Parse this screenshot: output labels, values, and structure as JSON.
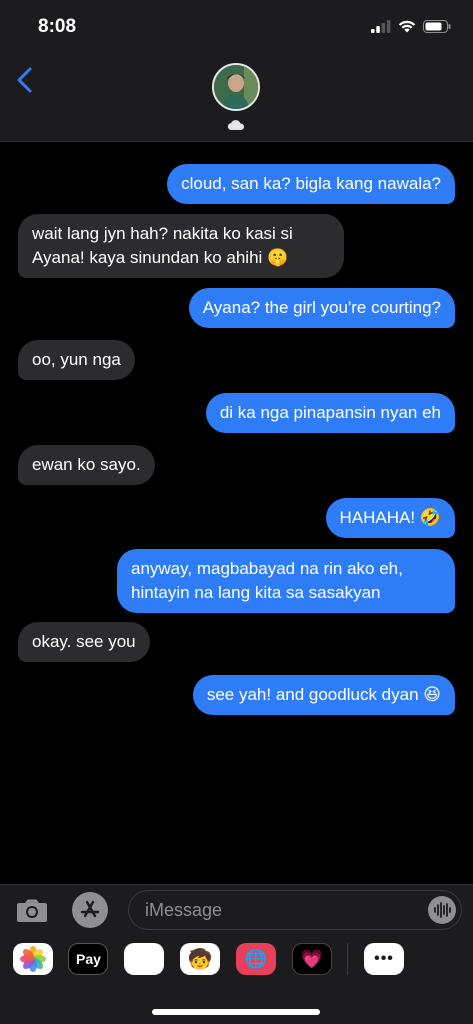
{
  "status": {
    "time": "8:08"
  },
  "header": {
    "avatar": "contact-avatar",
    "cloud_icon": "cloud-icon"
  },
  "messages": [
    {
      "dir": "out",
      "text": "cloud, san ka? bigla kang nawala?"
    },
    {
      "dir": "in",
      "text": "wait lang jyn hah? nakita ko kasi si Ayana! kaya sinundan ko ahihi 🤫"
    },
    {
      "dir": "out",
      "text": "Ayana? the girl you're courting?"
    },
    {
      "dir": "in",
      "text": "oo, yun nga"
    },
    {
      "dir": "out",
      "text": "di ka nga pinapansin nyan eh"
    },
    {
      "dir": "in",
      "text": "ewan ko sayo."
    },
    {
      "dir": "out",
      "text": "HAHAHA! 🤣"
    },
    {
      "dir": "out",
      "text": "anyway, magbabayad na rin ako eh, hintayin na lang kita sa sasakyan"
    },
    {
      "dir": "in",
      "text": "okay. see you"
    },
    {
      "dir": "out",
      "text": "see yah! and goodluck dyan 😆"
    }
  ],
  "composer": {
    "placeholder": "iMessage"
  },
  "apps": {
    "photos": "photos-app-icon",
    "apple_pay": "Pay",
    "animoji": "🐵",
    "memoji": "🧒",
    "search": "🌐",
    "heart": "💗",
    "more": "•••"
  },
  "colors": {
    "outgoing": "#2f7df6",
    "incoming": "#2c2c2e",
    "background": "#000000"
  }
}
